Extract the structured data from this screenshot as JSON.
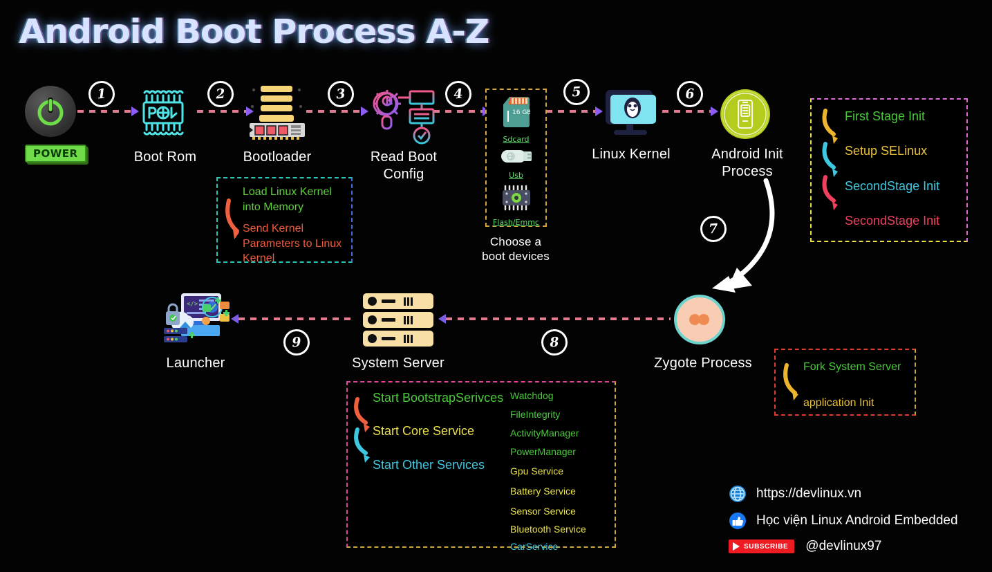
{
  "title": "Android Boot Process A-Z",
  "nodes": {
    "power": {
      "label": "POWER",
      "icon": "power-button-icon"
    },
    "boot_rom": {
      "label": "Boot Rom",
      "icon": "rom-chip-icon",
      "glyph": "ROM"
    },
    "bootloader": {
      "label": "Bootloader",
      "icon": "bootloader-memory-icon"
    },
    "read_boot_config": {
      "label": "Read Boot\nConfig",
      "line1": "Read Boot",
      "line2": "Config",
      "icon": "gear-wrench-config-icon"
    },
    "boot_devices": {
      "label": "Choose a\nboot devices",
      "line1": "Choose a",
      "line2": "boot devices"
    },
    "linux_kernel": {
      "label": "Linux Kernel",
      "icon": "monitor-penguin-icon"
    },
    "android_init": {
      "label": "Android Init\nProcess",
      "line1": "Android Init",
      "line2": "Process",
      "icon": "android-init-badge-icon"
    },
    "zygote": {
      "label": "Zygote Process",
      "icon": "zygote-cell-icon"
    },
    "system_server": {
      "label": "System Server",
      "icon": "server-rack-icon"
    },
    "launcher": {
      "label": "Launcher",
      "icon": "launcher-apps-icon"
    }
  },
  "steps": [
    "1",
    "2",
    "3",
    "4",
    "5",
    "6",
    "7",
    "8",
    "9"
  ],
  "boot_devices": [
    {
      "name": "Sdcard",
      "icon": "sdcard-icon",
      "capacity": "16 GB"
    },
    {
      "name": "Usb",
      "icon": "usb-drive-icon"
    },
    {
      "name": "Flash/Emmc",
      "icon": "flash-emmc-chip-icon"
    }
  ],
  "bootloader_detail": {
    "border_left_color": "#2ec4b6",
    "border_right_color": "#3f6fe0",
    "items": [
      {
        "text": "Load Linux Kernel into Memory",
        "color": "#5fd13d"
      },
      {
        "text": "Send Kernel Parameters to Linux Kernel",
        "color": "#f05a3c"
      }
    ],
    "arrow_color": "#f0603e"
  },
  "init_detail": {
    "border_left_color": "#e8e04a",
    "border_right_color": "#e06ad8",
    "items": [
      {
        "text": "First Stage Init",
        "color": "#49c93a"
      },
      {
        "text": "Setup SELinux",
        "color": "#e8c13a"
      },
      {
        "text": "SecondStage Init",
        "color": "#3ec8e0"
      },
      {
        "text": "SecondStage Init",
        "color": "#ef4060"
      }
    ],
    "arrow_colors": [
      "#edb52e",
      "#3ec8e0",
      "#ef4060"
    ]
  },
  "zygote_detail": {
    "border_left_color": "#e03c2e",
    "border_right_color": "#c3a33a",
    "items": [
      {
        "text": "Fork System Server",
        "color": "#49c93a"
      },
      {
        "text": "application Init",
        "color": "#e8c13a"
      }
    ],
    "arrow_color": "#edb52e"
  },
  "system_server_detail": {
    "border_left_color": "#e0449c",
    "border_right_color": "#c9a83c",
    "stages": [
      {
        "text": "Start BootstrapSerivces",
        "color": "#49c93a"
      },
      {
        "text": "Start Core Service",
        "color": "#e8e04a"
      },
      {
        "text": "Start Other Services",
        "color": "#3ec8e0"
      }
    ],
    "arrow_colors": [
      "#f0603e",
      "#3ec8e0"
    ],
    "services": [
      {
        "text": "Watchdog",
        "color": "#49c93a"
      },
      {
        "text": "FileIntegrity",
        "color": "#49c93a"
      },
      {
        "text": "ActivityManager",
        "color": "#49c93a"
      },
      {
        "text": "PowerManager",
        "color": "#49c93a"
      },
      {
        "text": "Gpu Service",
        "color": "#e8e04a"
      },
      {
        "text": "Battery Service",
        "color": "#e8e04a"
      },
      {
        "text": "Sensor Service",
        "color": "#e8e04a"
      },
      {
        "text": "Bluetooth Service",
        "color": "#e8e04a"
      },
      {
        "text": "CarService",
        "color": "#3ec8e0"
      }
    ]
  },
  "footer": [
    {
      "icon": "globe-icon",
      "text": "https://devlinux.vn"
    },
    {
      "icon": "thumbs-up-icon",
      "text": "Học viện Linux Android Embedded"
    },
    {
      "icon": "youtube-subscribe-icon",
      "badge": "SUBSCRIBE",
      "text": "@devlinux97"
    }
  ],
  "colors": {
    "background": "#000000",
    "title": "#d8e4ff",
    "flow_start": "#e2798f",
    "flow_end": "#8b5cf6",
    "step_circle": "#ffffff",
    "node_label": "#ffffff"
  }
}
